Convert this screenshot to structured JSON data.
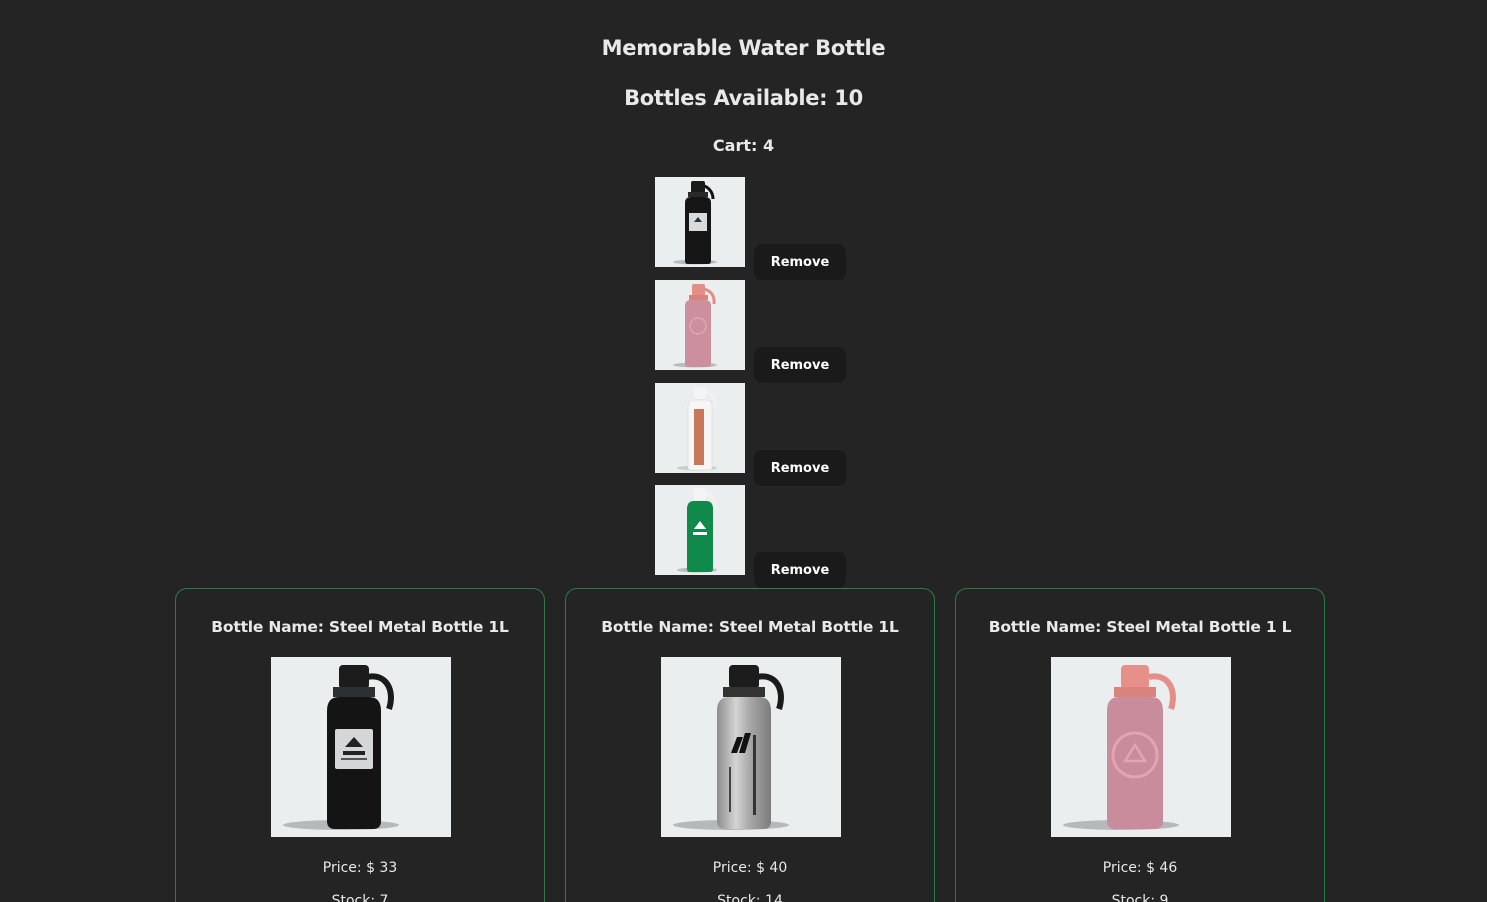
{
  "header": {
    "title": "Memorable Water Bottle",
    "available_label": "Bottles Available: 10",
    "cart_label": "Cart: 4"
  },
  "cart": {
    "items": [
      {
        "color": "black",
        "remove_label": "Remove"
      },
      {
        "color": "pink",
        "remove_label": "Remove"
      },
      {
        "color": "white",
        "remove_label": "Remove"
      },
      {
        "color": "green",
        "remove_label": "Remove"
      }
    ]
  },
  "products": [
    {
      "name": "Bottle Name: Steel Metal Bottle 1L",
      "price": "Price: $ 33",
      "stock": "Stock: 7",
      "color": "black"
    },
    {
      "name": "Bottle Name: Steel Metal Bottle 1L",
      "price": "Price: $ 40",
      "stock": "Stock: 14",
      "color": "silver"
    },
    {
      "name": "Bottle Name: Steel Metal Bottle 1 L",
      "price": "Price: $ 46",
      "stock": "Stock: 9",
      "color": "pink"
    }
  ],
  "colors": {
    "background": "#242424",
    "card_border": "#2f7a48",
    "button_bg": "#1a1a1a",
    "image_bg": "#ebeeef"
  }
}
